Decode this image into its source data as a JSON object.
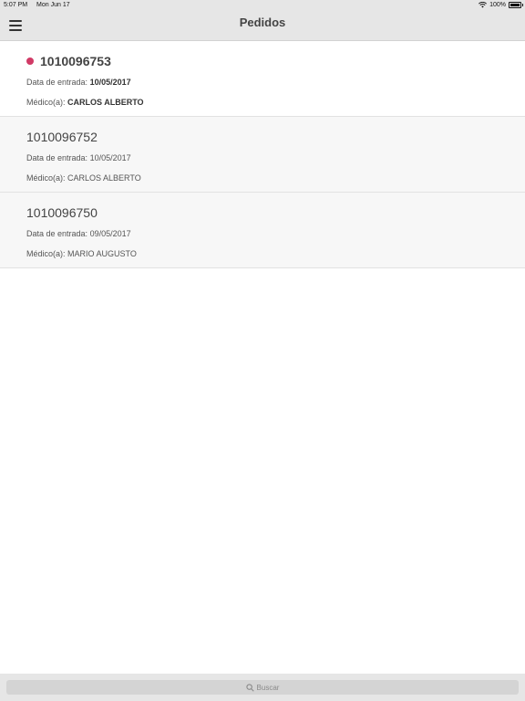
{
  "status_bar": {
    "time": "5:07 PM",
    "date": "Mon Jun 17",
    "battery": "100%"
  },
  "header": {
    "title": "Pedidos"
  },
  "orders": [
    {
      "id": "1010096753",
      "date_label": "Data de entrada:",
      "date": "10/05/2017",
      "doctor_label": "Médico(a):",
      "doctor": "CARLOS ALBERTO",
      "unread": true
    },
    {
      "id": "1010096752",
      "date_label": "Data de entrada:",
      "date": "10/05/2017",
      "doctor_label": "Médico(a):",
      "doctor": "CARLOS ALBERTO",
      "unread": false
    },
    {
      "id": "1010096750",
      "date_label": "Data de entrada:",
      "date": "09/05/2017",
      "doctor_label": "Médico(a):",
      "doctor": "MARIO AUGUSTO",
      "unread": false
    }
  ],
  "search": {
    "placeholder": "Buscar"
  },
  "colors": {
    "unread_dot": "#d13a66",
    "bar_bg": "#e6e6e6"
  }
}
